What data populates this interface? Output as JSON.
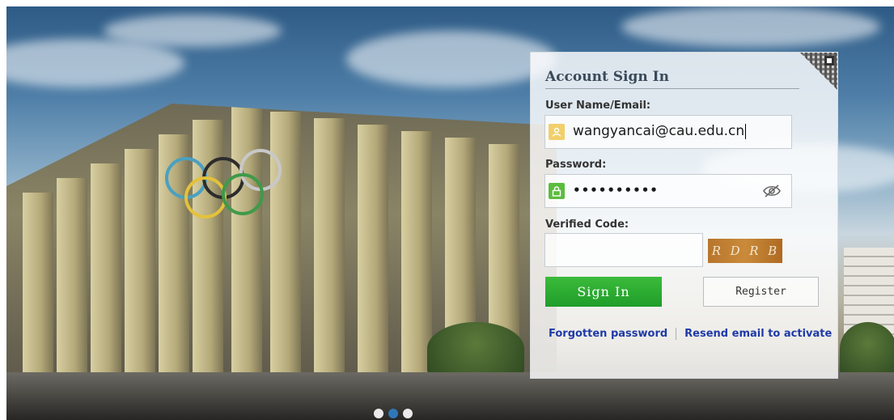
{
  "login": {
    "title": "Account Sign In",
    "username_label": "User Name/Email:",
    "username_value": "wangyancai@cau.edu.cn",
    "password_label": "Password:",
    "password_masked": "••••••••••",
    "code_label": "Verified Code:",
    "code_value": "",
    "captcha_text": [
      "R",
      "D",
      "R",
      "B"
    ],
    "signin_label": "Sign In",
    "register_label": "Register",
    "forgot_label": "Forgotten password",
    "resend_label": "Resend email to activate"
  },
  "carousel": {
    "slides": 3,
    "active_index": 1
  },
  "colors": {
    "signin_green": "#1f9d2a",
    "link_blue": "#1f3aa8",
    "user_icon_bg": "#f1cf6b",
    "lock_icon_bg": "#5cbc3e",
    "carousel_active": "#2f80c8"
  }
}
